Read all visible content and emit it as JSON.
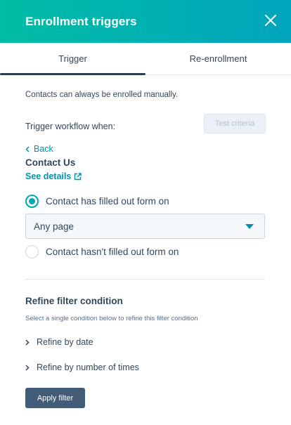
{
  "header": {
    "title": "Enrollment triggers",
    "close_icon": "close-icon"
  },
  "tabs": [
    {
      "label": "Trigger",
      "active": true
    },
    {
      "label": "Re-enrollment",
      "active": false
    }
  ],
  "note": "Contacts can always be enrolled manually.",
  "trigger_label": "Trigger workflow when:",
  "test_button": "Test criteria",
  "back_link": "Back",
  "form_name": "Contact Us",
  "details_link": "See details",
  "radios": [
    {
      "label": "Contact has filled out form on",
      "checked": true
    },
    {
      "label": "Contact hasn't filled out form on",
      "checked": false
    }
  ],
  "select": {
    "value": "Any page"
  },
  "refine": {
    "title": "Refine filter condition",
    "subtitle": "Select a single condition below to refine this filter condition",
    "items": [
      "Refine by date",
      "Refine by number of times"
    ]
  },
  "apply_button": "Apply filter",
  "colors": {
    "header_start": "#00bda5",
    "header_end": "#00a4bd",
    "link": "#0091ae",
    "primary_button": "#425b76"
  }
}
